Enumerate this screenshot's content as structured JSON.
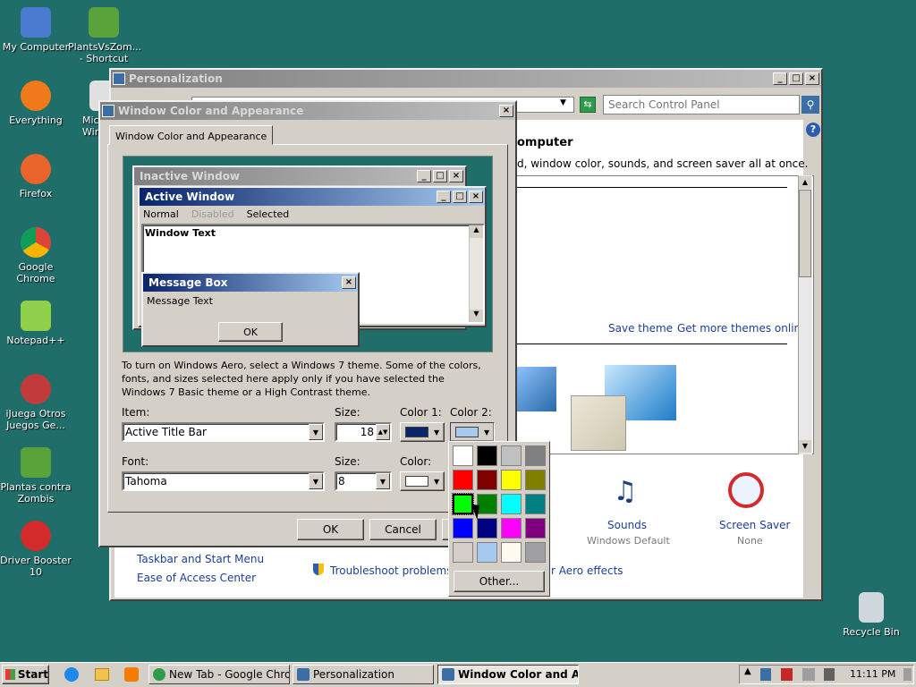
{
  "desktop": {
    "icons": [
      {
        "label": "My Computer",
        "icon": "computer-icon",
        "color": "#4a7bd1"
      },
      {
        "label": "PlantsVsZom... - Shortcut",
        "icon": "plants-icon",
        "color": "#5aa33b"
      },
      {
        "label": "Everything",
        "icon": "magnifier-icon",
        "color": "#f07a1a"
      },
      {
        "label": "Micr... Wind...",
        "icon": "document-icon",
        "color": "#e0e0e0"
      },
      {
        "label": "Firefox",
        "icon": "firefox-icon",
        "color": "#e8642b"
      },
      {
        "label": "Google Chrome",
        "icon": "chrome-icon",
        "color": "#2e9a4c"
      },
      {
        "label": "Notepad++",
        "icon": "notepad-icon",
        "color": "#8fcf4a"
      },
      {
        "label": "iJuega Otros Juegos Ge...",
        "icon": "popcap-icon",
        "color": "#c23b3b"
      },
      {
        "label": "Plantas contra Zombis",
        "icon": "plants-icon",
        "color": "#5aa33b"
      },
      {
        "label": "Driver Booster 10",
        "icon": "booster-icon",
        "color": "#d32b2b"
      },
      {
        "label": "Recycle Bin",
        "icon": "recycle-bin-icon",
        "color": "#cfd8dc"
      }
    ]
  },
  "personalization": {
    "title": "Personalization",
    "search_placeholder": "Search Control Panel",
    "heading_partial": "omputer",
    "subtitle_partial": "d, window color, sounds, and screen saver all at once.",
    "save_theme": "Save theme",
    "more_themes": "Get more themes online",
    "sounds_label": "Sounds",
    "sounds_value": "Windows Default",
    "screensaver_label": "Screen Saver",
    "screensaver_value": "None",
    "link_taskbar": "Taskbar and Start Menu",
    "link_ease": "Ease of Access Center",
    "link_troubleshoot": "Troubleshoot problems with",
    "link_aero": "r Aero effects"
  },
  "dialog": {
    "title": "Window Color and Appearance",
    "tab": "Window Color and Appearance",
    "preview": {
      "inactive_title": "Inactive Window",
      "active_title": "Active Window",
      "menu_normal": "Normal",
      "menu_disabled": "Disabled",
      "menu_selected": "Selected",
      "window_text": "Window Text",
      "msgbox_title": "Message Box",
      "msgbox_text": "Message Text",
      "msgbox_ok": "OK"
    },
    "info_text": "To turn on Windows Aero, select a Windows 7 theme.  Some of the colors, fonts, and sizes selected here apply only if you have selected the Windows 7 Basic theme or a High Contrast theme.",
    "item_label": "Item:",
    "item_value": "Active Title Bar",
    "size_label": "Size:",
    "size_value": "18",
    "color1_label": "Color 1:",
    "color1_value": "#0a246a",
    "color2_label": "Color 2:",
    "color2_value": "#a6caf0",
    "font_label": "Font:",
    "font_value": "Tahoma",
    "font_size_label": "Size:",
    "font_size_value": "8",
    "font_color_label": "Color:",
    "font_color_value": "#ffffff",
    "ok": "OK",
    "cancel": "Cancel"
  },
  "palette": {
    "colors": [
      "#ffffff",
      "#000000",
      "#c0c0c0",
      "#808080",
      "#ff0000",
      "#800000",
      "#ffff00",
      "#808000",
      "#00ff00",
      "#008000",
      "#00ffff",
      "#008080",
      "#0000ff",
      "#000080",
      "#ff00ff",
      "#800080",
      "#d4d0c8",
      "#a6caf0",
      "#fffbf0",
      "#a0a0a4"
    ],
    "selected_index": 8,
    "other_label": "Other..."
  },
  "taskbar": {
    "start": "Start",
    "buttons": [
      {
        "label": "New Tab - Google Chrome",
        "icon": "chrome-icon",
        "color": "#2e9a4c"
      },
      {
        "label": "Personalization",
        "icon": "control-panel-icon",
        "color": "#3a6ea5"
      },
      {
        "label": "Window Color and Ap...",
        "icon": "window-color-icon",
        "color": "#3a6ea5"
      }
    ],
    "clock": "11:11 PM"
  }
}
